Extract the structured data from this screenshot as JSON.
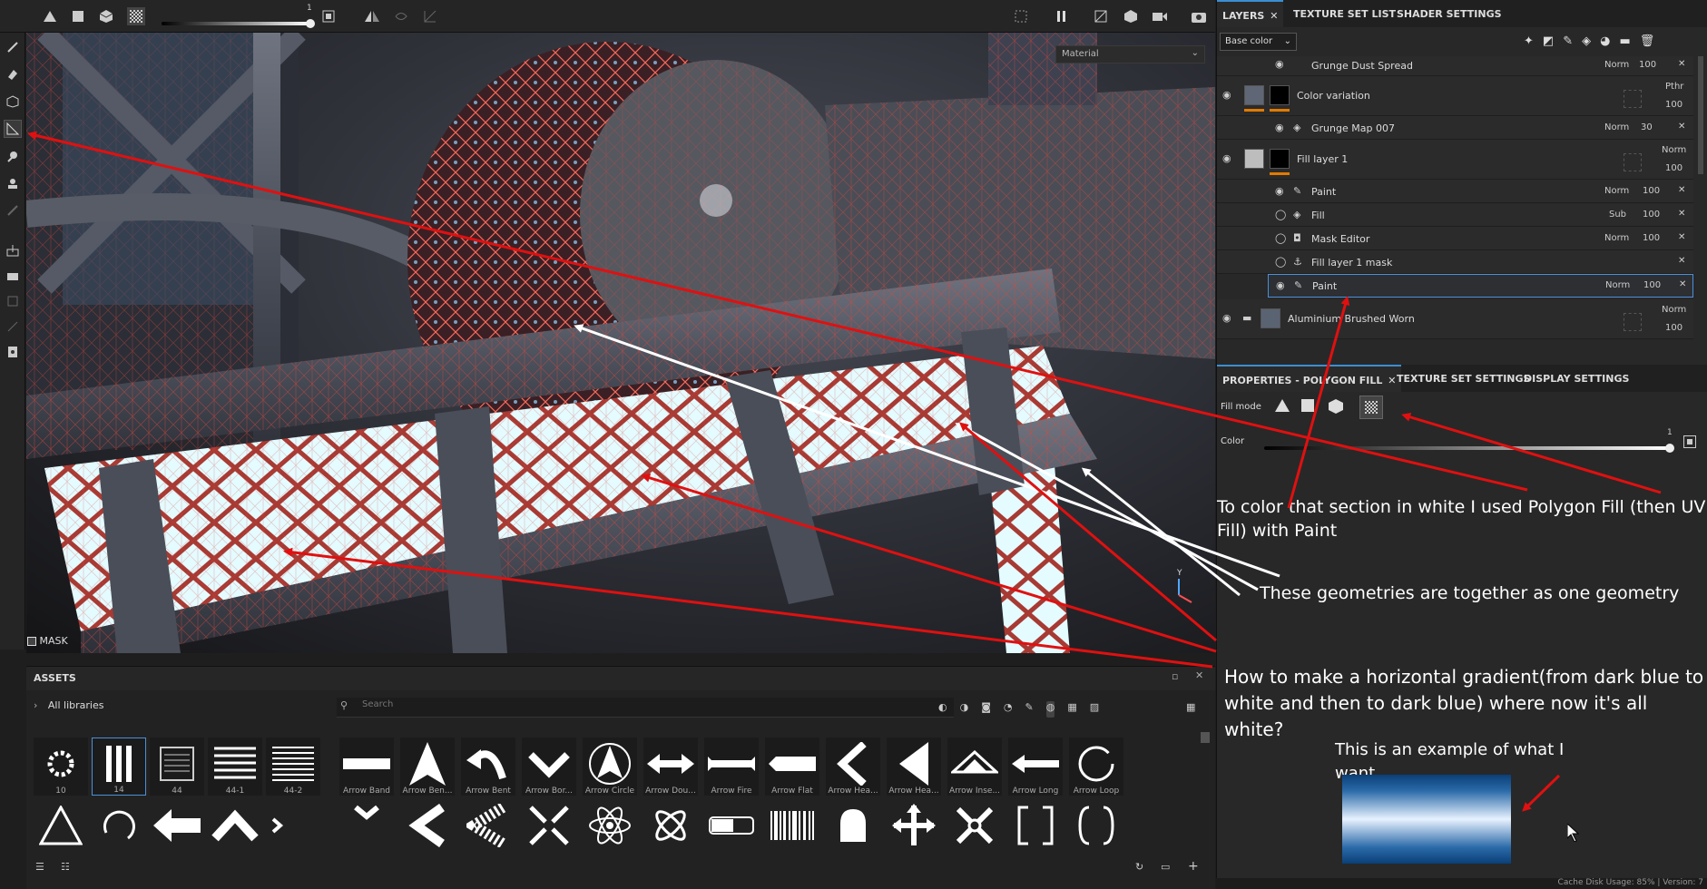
{
  "toolbar": {
    "slider_value": "1"
  },
  "viewport": {
    "material_select": "Material",
    "mask_label": "MASK"
  },
  "layers_panel": {
    "tabs": [
      "LAYERS",
      "TEXTURE SET LIST",
      "SHADER SETTINGS"
    ],
    "channel_select": "Base color",
    "layers": [
      {
        "name": "Grunge Dust Spread",
        "blend": "Norm",
        "opacity": "100"
      },
      {
        "name": "Color variation",
        "blend": "Pthr",
        "opacity": "100"
      },
      {
        "name": "Grunge Map 007",
        "blend": "Norm",
        "opacity": "30"
      },
      {
        "name": "Fill layer 1",
        "blend": "Norm",
        "opacity": "100"
      },
      {
        "name": "Paint",
        "blend": "Norm",
        "opacity": "100"
      },
      {
        "name": "Fill",
        "blend": "Sub",
        "opacity": "100"
      },
      {
        "name": "Mask Editor",
        "blend": "Norm",
        "opacity": "100"
      },
      {
        "name": "Fill layer 1 mask",
        "blend": "",
        "opacity": ""
      },
      {
        "name": "Paint",
        "blend": "Norm",
        "opacity": "100"
      },
      {
        "name": "Aluminium Brushed Worn",
        "blend": "Norm",
        "opacity": "100"
      }
    ]
  },
  "properties_panel": {
    "tabs": [
      "PROPERTIES - POLYGON FILL",
      "TEXTURE SET SETTINGS",
      "DISPLAY SETTINGS"
    ],
    "fill_mode_label": "Fill mode",
    "color_label": "Color",
    "color_value": "1"
  },
  "assets": {
    "title": "ASSETS",
    "library": "All libraries",
    "search_placeholder": "Search",
    "row1": [
      "10",
      "14",
      "44",
      "44-1",
      "44-2",
      "Arrow Band",
      "Arrow Ben...",
      "Arrow Bent",
      "Arrow Bor...",
      "Arrow Circle",
      "Arrow Dou...",
      "Arrow Fire",
      "Arrow Flat",
      "Arrow Hea...",
      "Arrow Hea...",
      "Arrow Inse...",
      "Arrow Long",
      "Arrow Loop"
    ]
  },
  "annotations": {
    "a1": "To color that section in white I used Polygon Fill (then UV Fill) with Paint",
    "a2": "These geometries are together as one geometry",
    "a3": "How to make a horizontal gradient(from dark blue to white and then to dark blue) where now it's all white?",
    "a4": "This is an example of what I want"
  },
  "status": "Cache Disk Usage:   85% | Version: 7",
  "colors": {
    "accent": "#3b8fd4",
    "arrow_red": "#e01010",
    "wire_red": "#d9473f",
    "gradient_dark": "#0a3f78"
  }
}
